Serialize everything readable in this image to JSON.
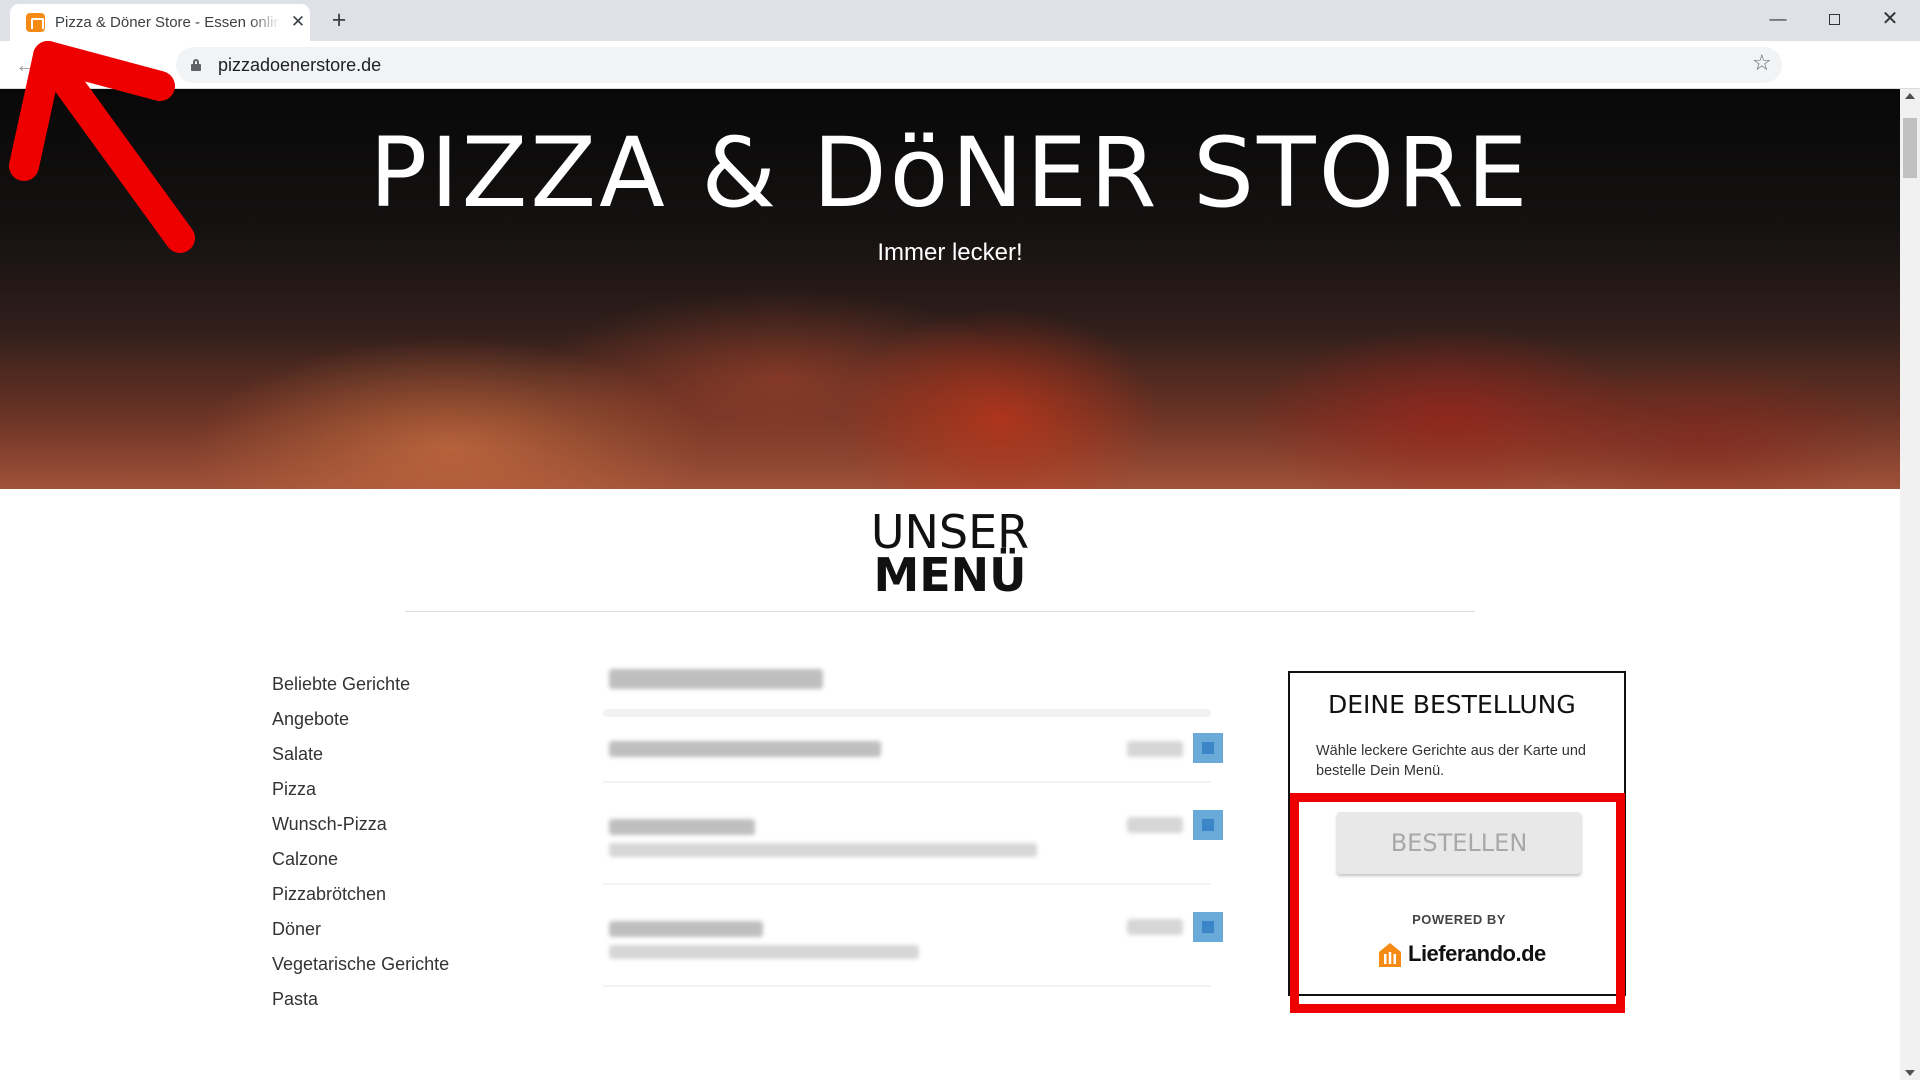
{
  "browser": {
    "tab_title": "Pizza & Döner Store - Essen online bestellen",
    "url": "pizzadoenerstore.de",
    "new_tab": "+",
    "close_tab": "✕"
  },
  "hero": {
    "title": "PIZZA & DöNER STORE",
    "subtitle": "Immer lecker!"
  },
  "menu_heading": {
    "line1": "UNSER",
    "line2": "MENÜ"
  },
  "categories": [
    "Beliebte Gerichte",
    "Angebote",
    "Salate",
    "Pizza",
    "Wunsch-Pizza",
    "Calzone",
    "Pizzabrötchen",
    "Döner",
    "Vegetarische Gerichte",
    "Pasta"
  ],
  "order": {
    "title": "DEINE BESTELLUNG",
    "text": "Wähle leckere Gerichte aus der Karte und bestelle Dein Menü.",
    "button": "BESTELLEN",
    "powered_by": "POWERED BY",
    "brand": "Lieferando.de"
  },
  "colors": {
    "highlight": "#ee0000",
    "brand_orange": "#f58a14",
    "add_button": "#6aaad8"
  }
}
